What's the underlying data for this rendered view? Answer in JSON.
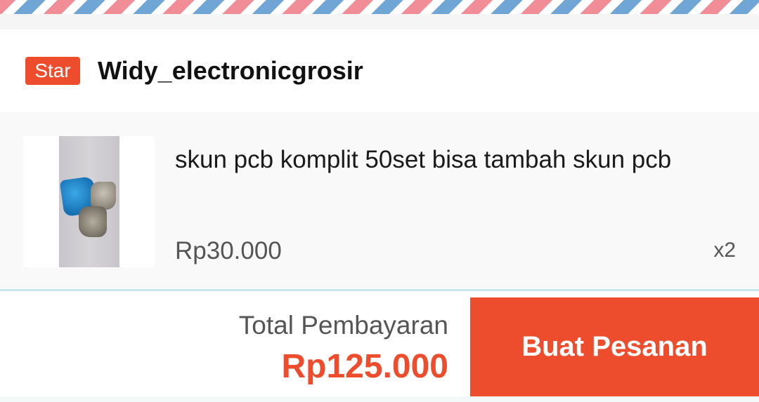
{
  "colors": {
    "accent": "#ee4d2d",
    "stripe_blue": "#6fa6d6",
    "stripe_pink": "#f08d96"
  },
  "shop": {
    "badge": "Star",
    "name": "Widy_electronicgrosir"
  },
  "product": {
    "title": "skun pcb komplit 50set bisa tambah skun pcb",
    "price": "Rp30.000",
    "quantity": "x2",
    "image_icon": "product-photo"
  },
  "checkout": {
    "total_label": "Total Pembayaran",
    "total_value": "Rp125.000",
    "order_button_label": "Buat Pesanan"
  }
}
